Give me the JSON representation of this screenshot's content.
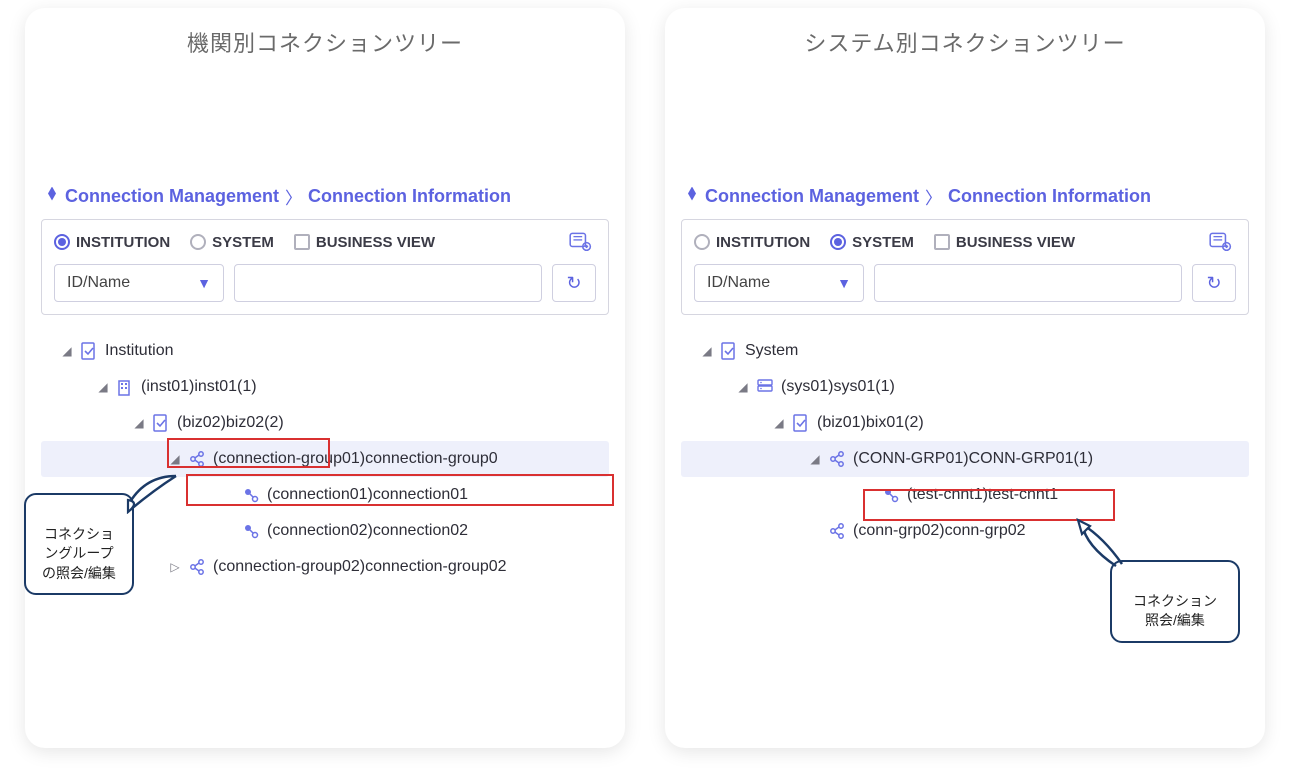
{
  "left": {
    "title": "機関別コネクションツリー",
    "breadcrumb": {
      "a": "Connection Management",
      "b": "Connection Information"
    },
    "filters": {
      "institution": "INSTITUTION",
      "system": "SYSTEM",
      "business_view": "BUSINESS VIEW",
      "selected": "INSTITUTION",
      "select_label": "ID/Name"
    },
    "tree": {
      "root": "Institution",
      "n1": "(inst01)inst01(1)",
      "n2": "(biz02)biz02(2)",
      "n3": "(connection-group01)connection-group0",
      "n4": "(connection01)connection01",
      "n5": "(connection02)connection02",
      "n6": "(connection-group02)connection-group02"
    },
    "callout": "コネクショ\nングループ\nの照会/編集"
  },
  "right": {
    "title": "システム別コネクションツリー",
    "breadcrumb": {
      "a": "Connection Management",
      "b": "Connection Information"
    },
    "filters": {
      "institution": "INSTITUTION",
      "system": "SYSTEM",
      "business_view": "BUSINESS VIEW",
      "selected": "SYSTEM",
      "select_label": "ID/Name"
    },
    "tree": {
      "root": "System",
      "n1": "(sys01)sys01(1)",
      "n2": "(biz01)bix01(2)",
      "n3": "(CONN-GRP01)CONN-GRP01(1)",
      "n4": "(test-cnnt1)test-cnnt1",
      "n5": "(conn-grp02)conn-grp02"
    },
    "callout": "コネクション\n照会/編集"
  }
}
